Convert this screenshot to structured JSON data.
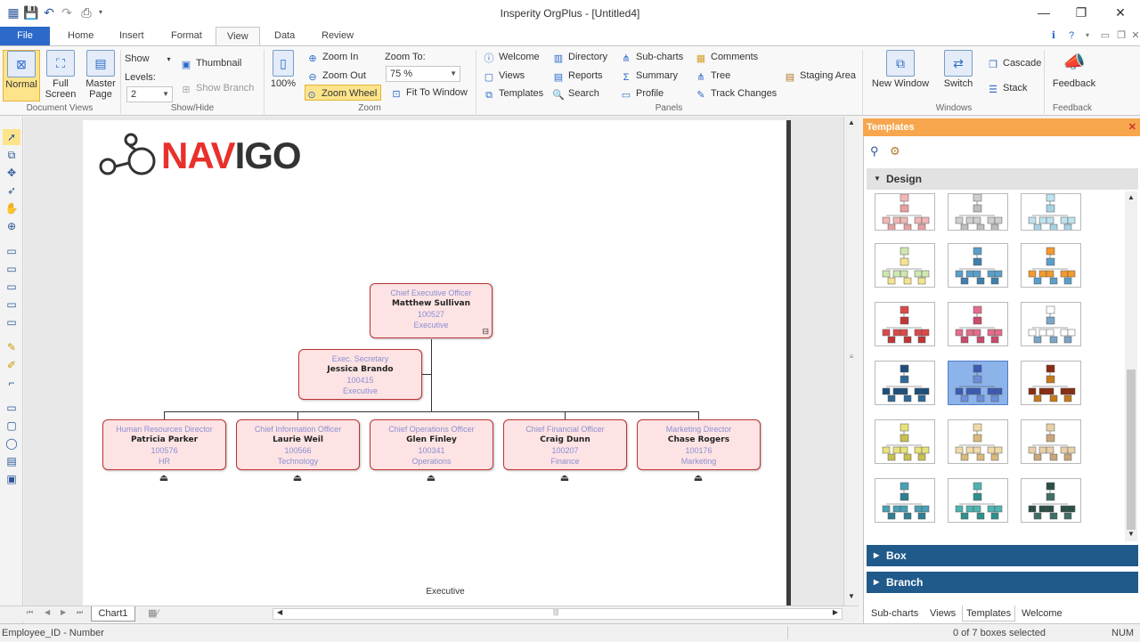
{
  "app": {
    "title": "Insperity OrgPlus - [Untitled4]"
  },
  "tabs": [
    "File",
    "Home",
    "Insert",
    "Format",
    "View",
    "Data",
    "Review"
  ],
  "ribbon": {
    "document_views": {
      "label": "Document Views",
      "normal": "Normal",
      "full_screen": "Full Screen",
      "master_page": "Master Page"
    },
    "show_hide": {
      "label": "Show/Hide",
      "show": "Show",
      "levels": "Levels:",
      "levels_value": "2",
      "thumbnail": "Thumbnail",
      "show_branch": "Show Branch"
    },
    "zoom": {
      "label": "Zoom",
      "pct": "100%",
      "zoom_in": "Zoom In",
      "zoom_out": "Zoom Out",
      "zoom_wheel": "Zoom Wheel",
      "zoom_to": "Zoom To:",
      "zoom_value": "75 %",
      "fit_to_window": "Fit To Window"
    },
    "panels": {
      "label": "Panels",
      "welcome": "Welcome",
      "views": "Views",
      "templates": "Templates",
      "directory": "Directory",
      "reports": "Reports",
      "search": "Search",
      "sub_charts": "Sub-charts",
      "summary": "Summary",
      "profile": "Profile",
      "comments": "Comments",
      "tree": "Tree",
      "track_changes": "Track Changes",
      "staging_area": "Staging Area"
    },
    "windows": {
      "label": "Windows",
      "new_window": "New Window",
      "switch": "Switch",
      "cascade": "Cascade",
      "stack": "Stack"
    },
    "feedback": {
      "label": "Feedback",
      "feedback": "Feedback"
    }
  },
  "chart": {
    "logo": "NAVIGO",
    "footer": "Executive",
    "root": {
      "title": "Chief Executive Officer",
      "name": "Matthew Sullivan",
      "id": "100527",
      "dept": "Executive"
    },
    "assistant": {
      "title": "Exec. Secretary",
      "name": "Jessica Brando",
      "id": "100415",
      "dept": "Executive"
    },
    "children": [
      {
        "title": "Human Resources Director",
        "name": "Patricia Parker",
        "id": "100576",
        "dept": "HR"
      },
      {
        "title": "Chief Information Officer",
        "name": "Laurie Weil",
        "id": "100566",
        "dept": "Technology"
      },
      {
        "title": "Chief Operations Officer",
        "name": "Glen Finley",
        "id": "100341",
        "dept": "Operations"
      },
      {
        "title": "Chief Financial Officer",
        "name": "Craig Dunn",
        "id": "100207",
        "dept": "Finance"
      },
      {
        "title": "Marketing Director",
        "name": "Chase Rogers",
        "id": "100176",
        "dept": "Marketing"
      }
    ]
  },
  "sheet_tab": "Chart1",
  "panel": {
    "title": "Templates",
    "design": "Design",
    "box": "Box",
    "branch": "Branch",
    "tabs": [
      "Sub-charts",
      "Views",
      "Templates",
      "Welcome"
    ]
  },
  "status": {
    "left": "Employee_ID - Number",
    "selection": "0 of 7 boxes selected",
    "num": "NUM"
  }
}
